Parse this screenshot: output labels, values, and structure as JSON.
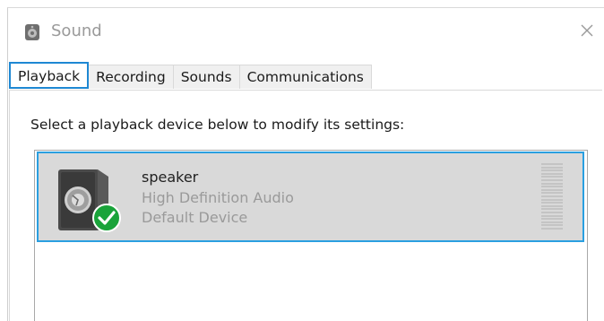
{
  "window": {
    "title": "Sound"
  },
  "tabs": [
    {
      "label": "Playback",
      "active": true
    },
    {
      "label": "Recording",
      "active": false
    },
    {
      "label": "Sounds",
      "active": false
    },
    {
      "label": "Communications",
      "active": false
    }
  ],
  "playback": {
    "instruction": "Select a playback device below to modify its settings:",
    "devices": [
      {
        "name": "speaker",
        "driver": "High Definition Audio",
        "status": "Default Device",
        "icon": "speaker-icon",
        "badge": "default-check-icon",
        "selected": true,
        "level": 0
      }
    ]
  },
  "colors": {
    "selection_border": "#2a9fe0",
    "selection_fill": "#d9d9d9",
    "active_tab_border": "#1e88d3",
    "default_badge": "#1aa33a"
  }
}
